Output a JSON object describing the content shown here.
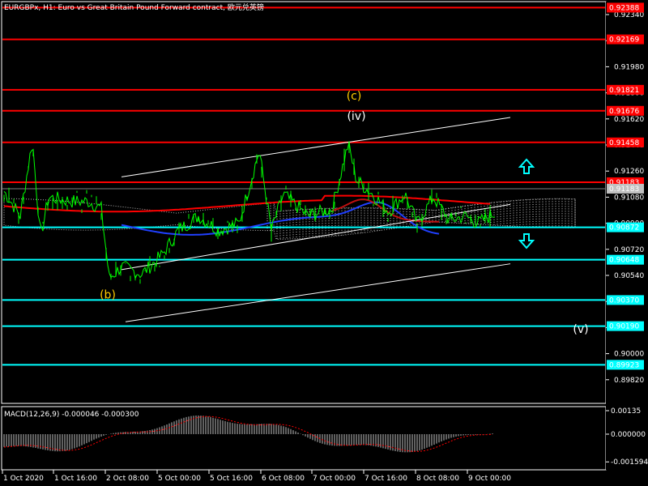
{
  "window": {
    "title": "EURGBPx, H1: Euro vs Great Britain Pound Forward contract, 欧元兑英镑",
    "background": "#000000",
    "frame_color": "#ffffff"
  },
  "indicator": {
    "label": "MACD(12,26,9) -0.000046 -0.000300",
    "ticks": [
      {
        "value": 0.00135,
        "label": "0.00135"
      },
      {
        "value": 0.0,
        "label": "0.000000"
      },
      {
        "value": -0.001594,
        "label": "-0.001594"
      }
    ],
    "histogram_color": "#c0c0c0",
    "signal_color": "#ff0000"
  },
  "x_axis": {
    "labels": [
      "1 Oct 2020",
      "1 Oct 16:00",
      "2 Oct 08:00",
      "5 Oct 00:00",
      "5 Oct 16:00",
      "6 Oct 08:00",
      "7 Oct 00:00",
      "7 Oct 16:00",
      "8 Oct 08:00",
      "9 Oct 00:00"
    ]
  },
  "chart_data": {
    "type": "line",
    "title": "EURGBPx, H1: Euro vs Great Britain Pound Forward contract, 欧元兑英镑",
    "ylim": [
      0.8968,
      0.9246
    ],
    "y_ticks": [
      0.9234,
      0.9216,
      0.9198,
      0.918,
      0.9162,
      0.9144,
      0.9126,
      0.9108,
      0.909,
      0.9072,
      0.9054,
      0.9036,
      0.9018,
      0.9,
      0.8982
    ],
    "resistance_levels": [
      {
        "value": 0.92388,
        "label": "0.92388"
      },
      {
        "value": 0.92169,
        "label": "0.92169"
      },
      {
        "value": 0.91821,
        "label": "0.91821"
      },
      {
        "value": 0.91676,
        "label": "0.91676"
      },
      {
        "value": 0.91458,
        "label": "0.91458"
      },
      {
        "value": 0.91183,
        "label": "0.91183"
      }
    ],
    "support_levels": [
      {
        "value": 0.90872,
        "label": "0.90872"
      },
      {
        "value": 0.90648,
        "label": "0.90648"
      },
      {
        "value": 0.9037,
        "label": "0.90370"
      },
      {
        "value": 0.9019,
        "label": "0.90190"
      },
      {
        "value": 0.89923,
        "label": "0.89923"
      }
    ],
    "current_price": {
      "value": 0.91183,
      "label": "0.91183"
    },
    "resistance_color": "#ff0000",
    "support_color": "#00ffff",
    "price_color": "#00ff00",
    "wave_labels": [
      {
        "text": "(c)",
        "color": "#ffcc00"
      },
      {
        "text": "(iv)",
        "color": "#ffffff"
      },
      {
        "text": "(b)",
        "color": "#ffcc00"
      },
      {
        "text": "(v)",
        "color": "#ffffff"
      }
    ]
  }
}
